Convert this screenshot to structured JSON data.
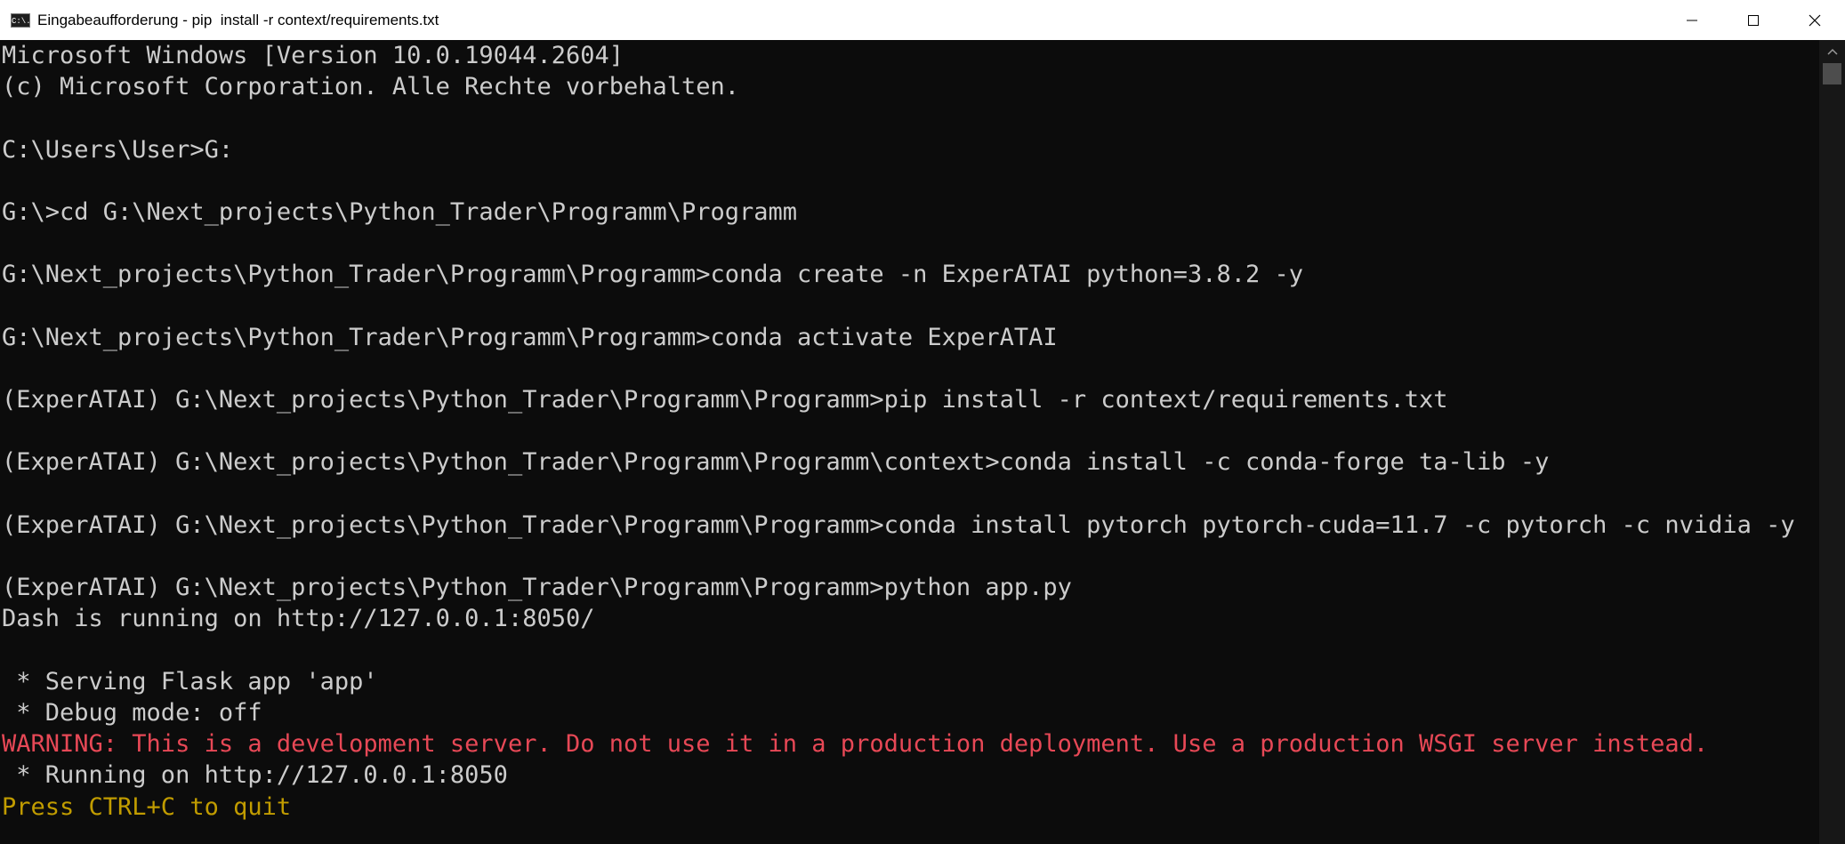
{
  "window": {
    "title": "Eingabeaufforderung - pip  install -r context/requirements.txt",
    "icon": "cmd-icon",
    "icon_text": "C:\\."
  },
  "colors": {
    "background": "#0c0c0c",
    "text": "#cccccc",
    "warning": "#e74856",
    "hint": "#c19c00"
  },
  "console": {
    "lines": [
      "Microsoft Windows [Version 10.0.19044.2604]",
      "(c) Microsoft Corporation. Alle Rechte vorbehalten.",
      "",
      "C:\\Users\\User>G:",
      "",
      "G:\\>cd G:\\Next_projects\\Python_Trader\\Programm\\Programm",
      "",
      "G:\\Next_projects\\Python_Trader\\Programm\\Programm>conda create -n ExperATAI python=3.8.2 -y",
      "",
      "G:\\Next_projects\\Python_Trader\\Programm\\Programm>conda activate ExperATAI",
      "",
      "(ExperATAI) G:\\Next_projects\\Python_Trader\\Programm\\Programm>pip install -r context/requirements.txt",
      "",
      "(ExperATAI) G:\\Next_projects\\Python_Trader\\Programm\\Programm\\context>conda install -c conda-forge ta-lib -y",
      "",
      "(ExperATAI) G:\\Next_projects\\Python_Trader\\Programm\\Programm>conda install pytorch pytorch-cuda=11.7 -c pytorch -c nvidia -y",
      "",
      "(ExperATAI) G:\\Next_projects\\Python_Trader\\Programm\\Programm>python app.py",
      "Dash is running on http://127.0.0.1:8050/",
      "",
      " * Serving Flask app 'app'",
      " * Debug mode: off",
      "WARNING: This is a development server. Do not use it in a production deployment. Use a production WSGI server instead.",
      " * Running on http://127.0.0.1:8050",
      "Press CTRL+C to quit"
    ]
  }
}
